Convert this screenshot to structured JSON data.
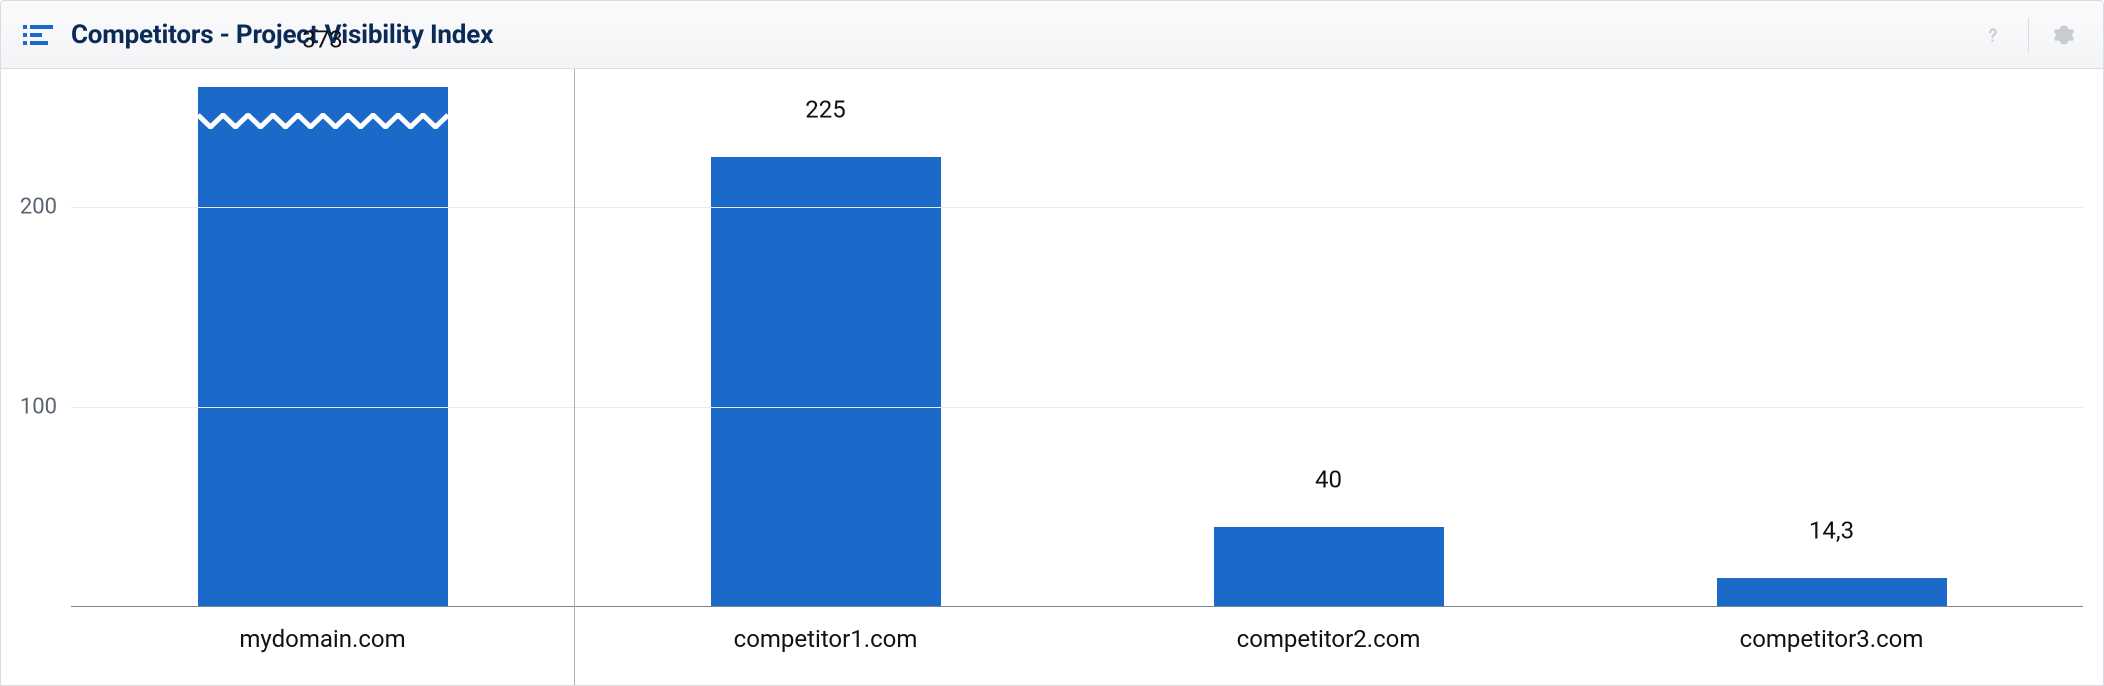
{
  "header": {
    "title": "Competitors - Project Visibility Index"
  },
  "chart_data": {
    "type": "bar",
    "title": "Competitors - Project Visibility Index",
    "xlabel": "",
    "ylabel": "",
    "categories": [
      "mydomain.com",
      "competitor1.com",
      "competitor2.com",
      "competitor3.com"
    ],
    "values": [
      373,
      225,
      40,
      14.3
    ],
    "value_labels": [
      "373",
      "225",
      "40",
      "14,3"
    ],
    "yticks": [
      100,
      200
    ],
    "ylim": [
      0,
      260
    ],
    "y_axis_broken_above": 260,
    "bar_color": "#1b6ac9"
  }
}
